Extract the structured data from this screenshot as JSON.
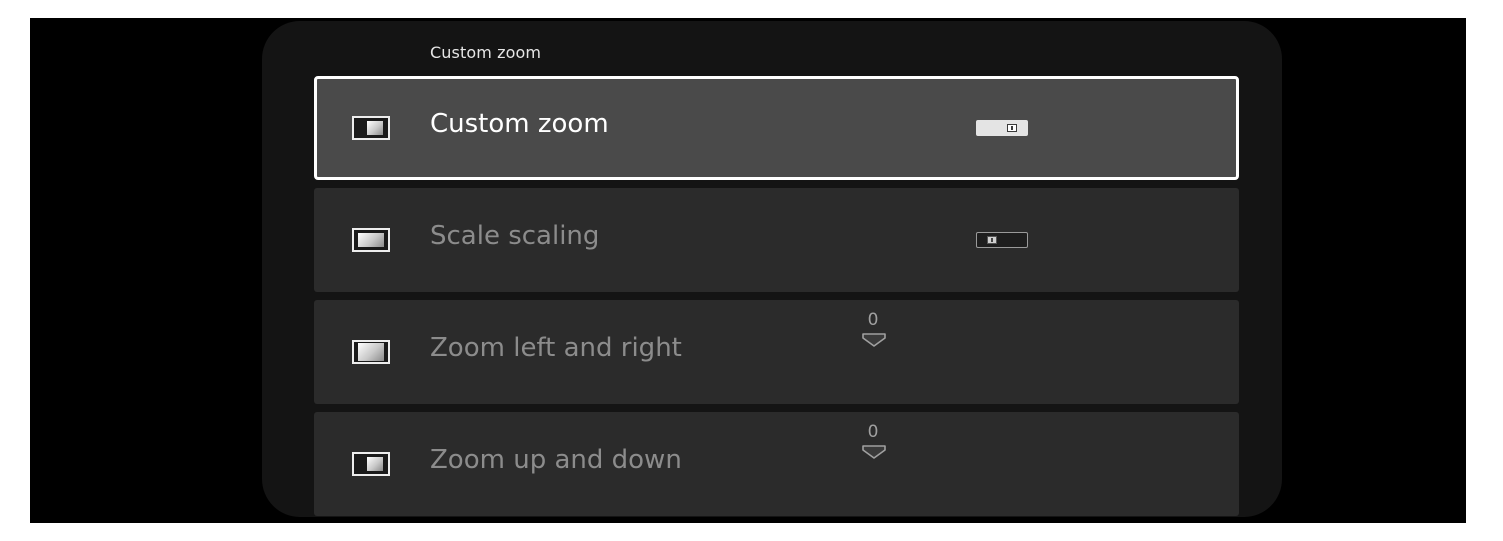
{
  "panel": {
    "title": "Custom zoom"
  },
  "rows": [
    {
      "label": "Custom zoom",
      "icon": "zoom-custom-icon",
      "control": "toggle",
      "state": "on",
      "focused": true
    },
    {
      "label": "Scale scaling",
      "icon": "scale-scaling-icon",
      "control": "toggle",
      "state": "off",
      "focused": false
    },
    {
      "label": "Zoom left and right",
      "icon": "zoom-horizontal-icon",
      "control": "stepper",
      "value": "0",
      "focused": false
    },
    {
      "label": "Zoom up and down",
      "icon": "zoom-vertical-icon",
      "control": "stepper",
      "value": "0",
      "focused": false
    }
  ],
  "colors": {
    "panel_background": "#141414",
    "row_background": "#2b2b2b",
    "focused_row_background": "#4a4a4a",
    "focus_border": "#ffffff",
    "dim_text": "#8c8c8c"
  }
}
